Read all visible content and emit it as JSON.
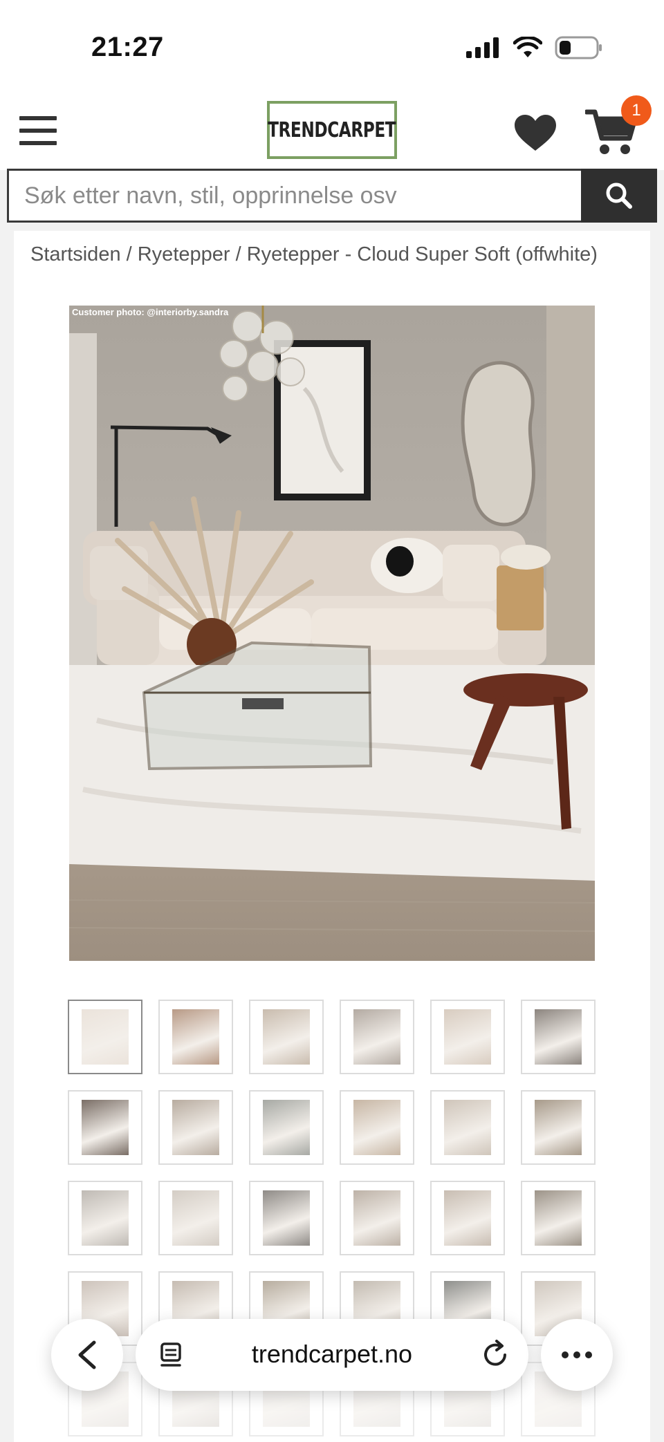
{
  "status_bar": {
    "time": "21:27"
  },
  "header": {
    "logo_text": "TRENDCARPET",
    "cart_count": "1"
  },
  "search": {
    "placeholder": "Søk etter navn, stil, opprinnelse osv"
  },
  "breadcrumb": "Startsiden / Ryetepper / Ryetepper - Cloud Super Soft (offwhite)",
  "product_photo": {
    "credit": "Customer photo: @interiorby.sandra"
  },
  "browser": {
    "url": "trendcarpet.no"
  },
  "colors": {
    "logo_border": "#7ca062",
    "badge": "#f05a1a",
    "search_button": "#2f2f2f"
  },
  "thumbnails": [
    {
      "tone": "#ebe3db"
    },
    {
      "tone": "#b89a86"
    },
    {
      "tone": "#c9bcae"
    },
    {
      "tone": "#b3aaa2"
    },
    {
      "tone": "#d8ccc0"
    },
    {
      "tone": "#8c857f"
    },
    {
      "tone": "#7a6e66"
    },
    {
      "tone": "#b8aca0"
    },
    {
      "tone": "#a7a9a4"
    },
    {
      "tone": "#c7b6a4"
    },
    {
      "tone": "#cfc5ba"
    },
    {
      "tone": "#a79a8a"
    },
    {
      "tone": "#bfbab4"
    },
    {
      "tone": "#d4cdc5"
    },
    {
      "tone": "#8f8b87"
    },
    {
      "tone": "#bdb2a7"
    },
    {
      "tone": "#c8bdb2"
    },
    {
      "tone": "#9c9388"
    },
    {
      "tone": "#cdc3bb"
    },
    {
      "tone": "#c6bcb2"
    },
    {
      "tone": "#b7ad9f"
    },
    {
      "tone": "#c3bbb1"
    },
    {
      "tone": "#8e8f8c"
    },
    {
      "tone": "#d0c8bf"
    },
    {
      "tone": "#e2ddd8"
    },
    {
      "tone": "#d9d3cd"
    },
    {
      "tone": "#e6e2de"
    },
    {
      "tone": "#e3dfdb"
    },
    {
      "tone": "#e0dcd7"
    },
    {
      "tone": "#e8e4e0"
    }
  ]
}
